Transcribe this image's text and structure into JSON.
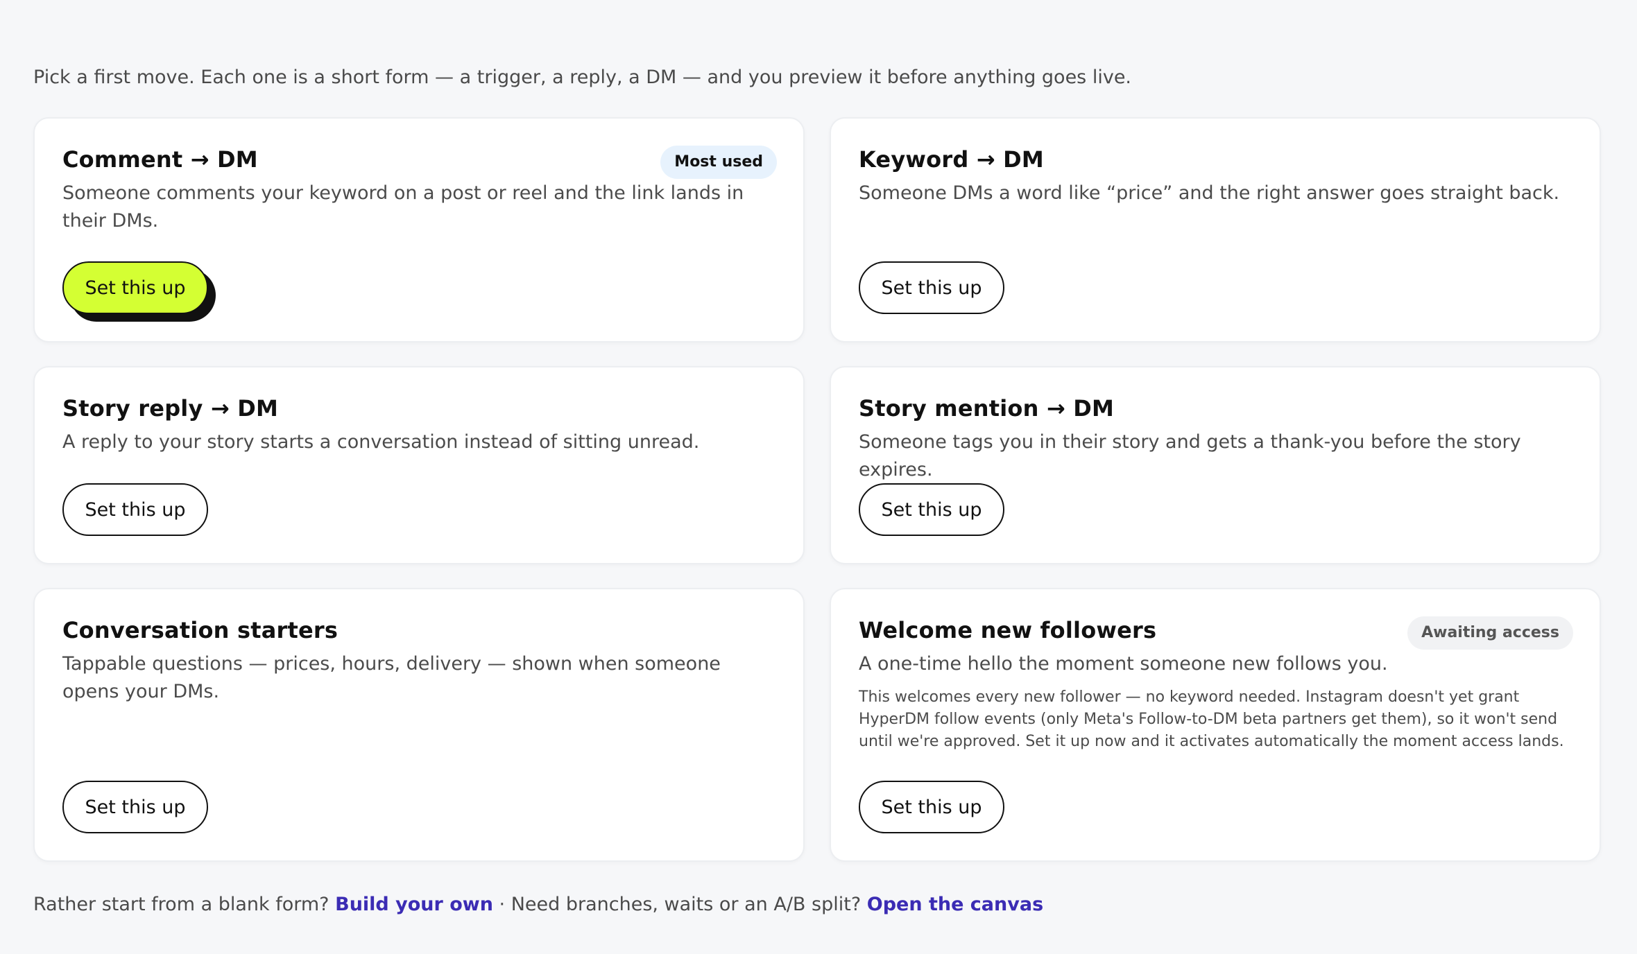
{
  "intro": "Pick a first move. Each one is a short form — a trigger, a reply, a DM — and you preview it before anything goes live.",
  "cards": [
    {
      "title": "Comment → DM",
      "badge": "Most used",
      "desc": "Someone comments your keyword on a post or reel and the link lands in their DMs.",
      "button": "Set this up"
    },
    {
      "title": "Keyword → DM",
      "desc": "Someone DMs a word like “price” and the right answer goes straight back.",
      "button": "Set this up"
    },
    {
      "title": "Story reply → DM",
      "desc": "A reply to your story starts a conversation instead of sitting unread.",
      "button": "Set this up"
    },
    {
      "title": "Story mention → DM",
      "desc": "Someone tags you in their story and gets a thank-you before the story expires.",
      "button": "Set this up"
    },
    {
      "title": "Conversation starters",
      "desc": "Tappable questions — prices, hours, delivery — shown when someone opens your DMs.",
      "button": "Set this up"
    },
    {
      "title": "Welcome new followers",
      "badge": "Awaiting access",
      "desc": "A one-time hello the moment someone new follows you.",
      "note": "This welcomes every new follower — no keyword needed. Instagram doesn't yet grant HyperDM follow events (only Meta's Follow-to-DM beta partners get them), so it won't send until we're approved. Set it up now and it activates automatically the moment access lands.",
      "button": "Set this up"
    }
  ],
  "footer": {
    "prefix": "Rather start from a blank form?",
    "link1": "Build your own",
    "middle": "· Need branches, waits or an A/B split?",
    "link2": "Open the canvas"
  }
}
